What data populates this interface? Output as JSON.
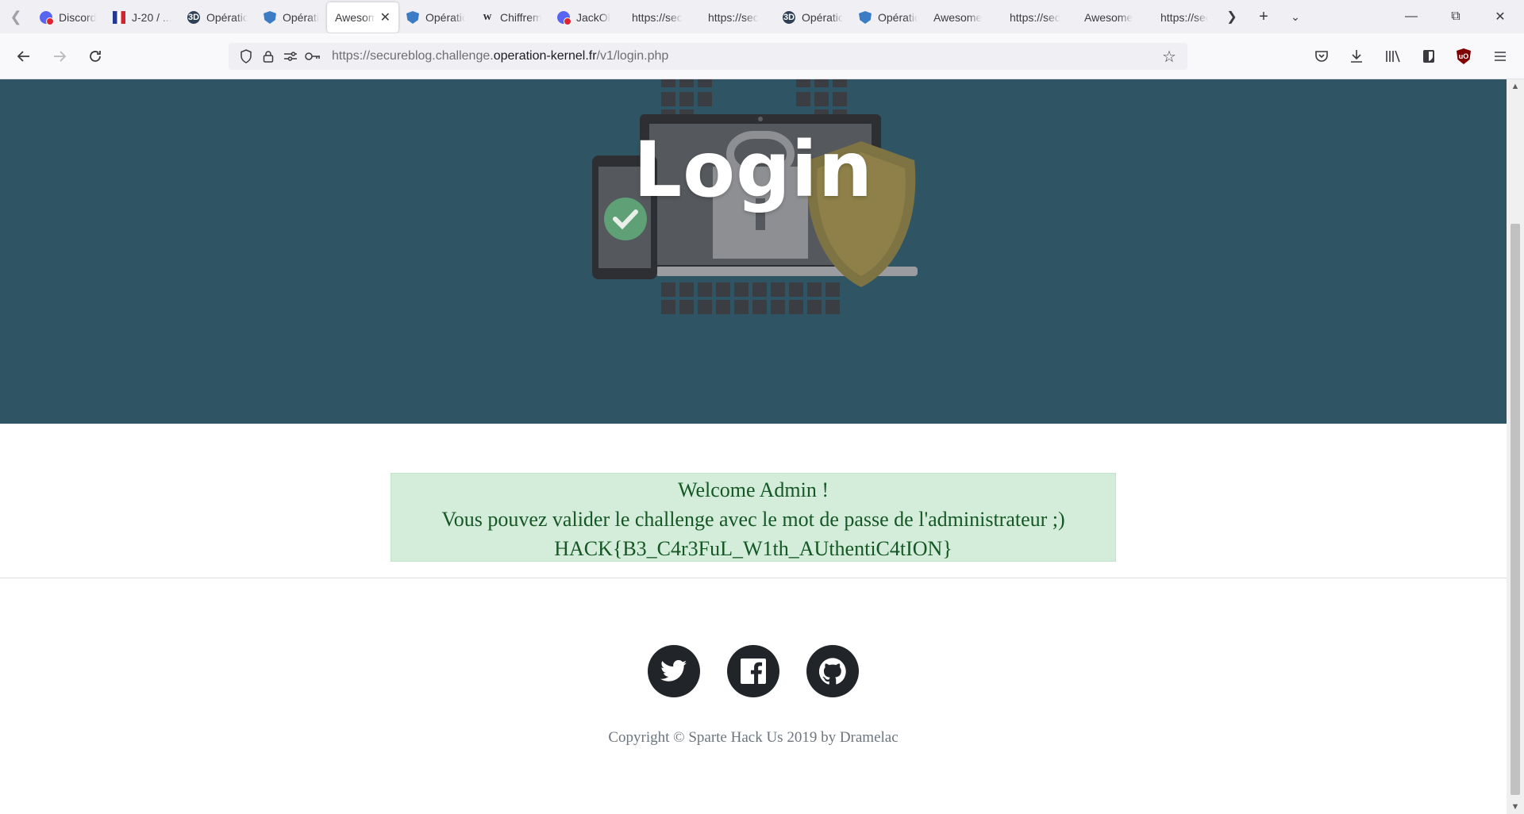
{
  "browser": {
    "tabs": [
      {
        "label": "Discord",
        "icon": "discord-icon"
      },
      {
        "label": "J-20 / ...",
        "icon": "france-flag-icon"
      },
      {
        "label": "Opération",
        "icon": "operation-kernel-icon"
      },
      {
        "label": "Opération",
        "icon": "shield-icon"
      },
      {
        "label": "Awesome",
        "icon": "none",
        "active": true
      },
      {
        "label": "Opération",
        "icon": "shield-icon"
      },
      {
        "label": "Chiffrement",
        "icon": "wikipedia-icon"
      },
      {
        "label": "JackOl",
        "icon": "discord-icon"
      },
      {
        "label": "https://sec",
        "icon": "none"
      },
      {
        "label": "https://sec",
        "icon": "none"
      },
      {
        "label": "Opération",
        "icon": "operation-kernel-icon"
      },
      {
        "label": "Opération",
        "icon": "shield-icon"
      },
      {
        "label": "Awesome",
        "icon": "none"
      },
      {
        "label": "https://sec",
        "icon": "none"
      },
      {
        "label": "Awesome",
        "icon": "none"
      },
      {
        "label": "https://sec",
        "icon": "none"
      }
    ],
    "url": {
      "prefix": "https://secureblog.challenge.",
      "host": "operation-kernel.fr",
      "path": "/v1/login.php"
    }
  },
  "page": {
    "hero_title": "Login",
    "alert": {
      "line1": "Welcome Admin !",
      "line2": "Vous pouvez valider le challenge avec le mot de passe de l'administrateur ;)",
      "line3": "HACK{B3_C4r3FuL_W1th_AUthentiC4tION}"
    },
    "social": [
      "twitter-icon",
      "facebook-icon",
      "github-icon"
    ],
    "copyright": "Copyright © Sparte Hack Us 2019 by Dramelac"
  },
  "colors": {
    "hero_bg": "#2f5565",
    "alert_bg": "#d4edda",
    "alert_text": "#155724",
    "social_bg": "#212529"
  }
}
